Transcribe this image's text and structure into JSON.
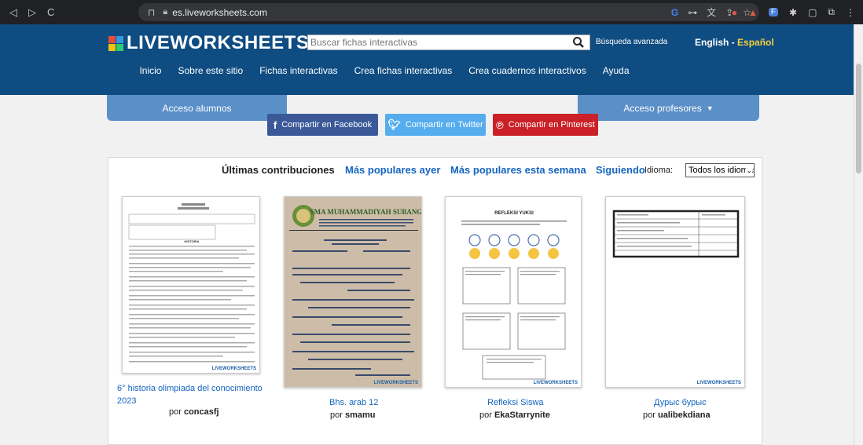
{
  "browser": {
    "url": "es.liveworksheets.com",
    "nav_icons": [
      "back-icon",
      "forward-icon",
      "reload-icon"
    ]
  },
  "header": {
    "logo_text": "LIVEWORKSHEETS",
    "logo_colors": [
      "#e74c3c",
      "#3498db",
      "#f1c40f",
      "#2ecc71"
    ],
    "search_placeholder": "Buscar fichas interactivas",
    "advanced_search": "Búsqueda avanzada",
    "lang_en": "English",
    "lang_sep": " - ",
    "lang_es": "Español",
    "menu": [
      "Inicio",
      "Sobre este sitio",
      "Fichas interactivas",
      "Crea fichas interactivas",
      "Crea cuadernos interactivos",
      "Ayuda"
    ]
  },
  "access": {
    "students": "Acceso alumnos",
    "teachers": "Acceso profesores"
  },
  "share": {
    "facebook": "Compartir en Facebook",
    "twitter": "Compartir en Twitter",
    "pinterest": "Compartir en Pinterest",
    "colors": {
      "facebook": "#3b5998",
      "twitter": "#55acee",
      "pinterest": "#cb2027"
    }
  },
  "tabs": {
    "latest": "Últimas contribuciones",
    "popular_yesterday": "Más populares ayer",
    "popular_week": "Más populares esta semana",
    "following": "Siguiendo",
    "language_label": "Idioma:",
    "language_value": "Todos los idiomas"
  },
  "cards": [
    {
      "title": "6° historia olimpiada del conocimiento 2023",
      "by": "por",
      "author": "concasfj"
    },
    {
      "title": "Bhs. arab 12",
      "by": "por",
      "author": "smamu"
    },
    {
      "title": "Refleksi Siswa",
      "by": "por",
      "author": "EkaStarrynite"
    },
    {
      "title": "Дурыс бурыс",
      "by": "por",
      "author": "ualibekdiana"
    }
  ],
  "thumb_texts": {
    "card1_heading": "HISTORIA",
    "card2_school": "SMA MUHAMMADIYAH SUBANG",
    "card3_heading": "REFLEKSI YUKSI",
    "watermark": "LIVEWORKSHEETS"
  }
}
